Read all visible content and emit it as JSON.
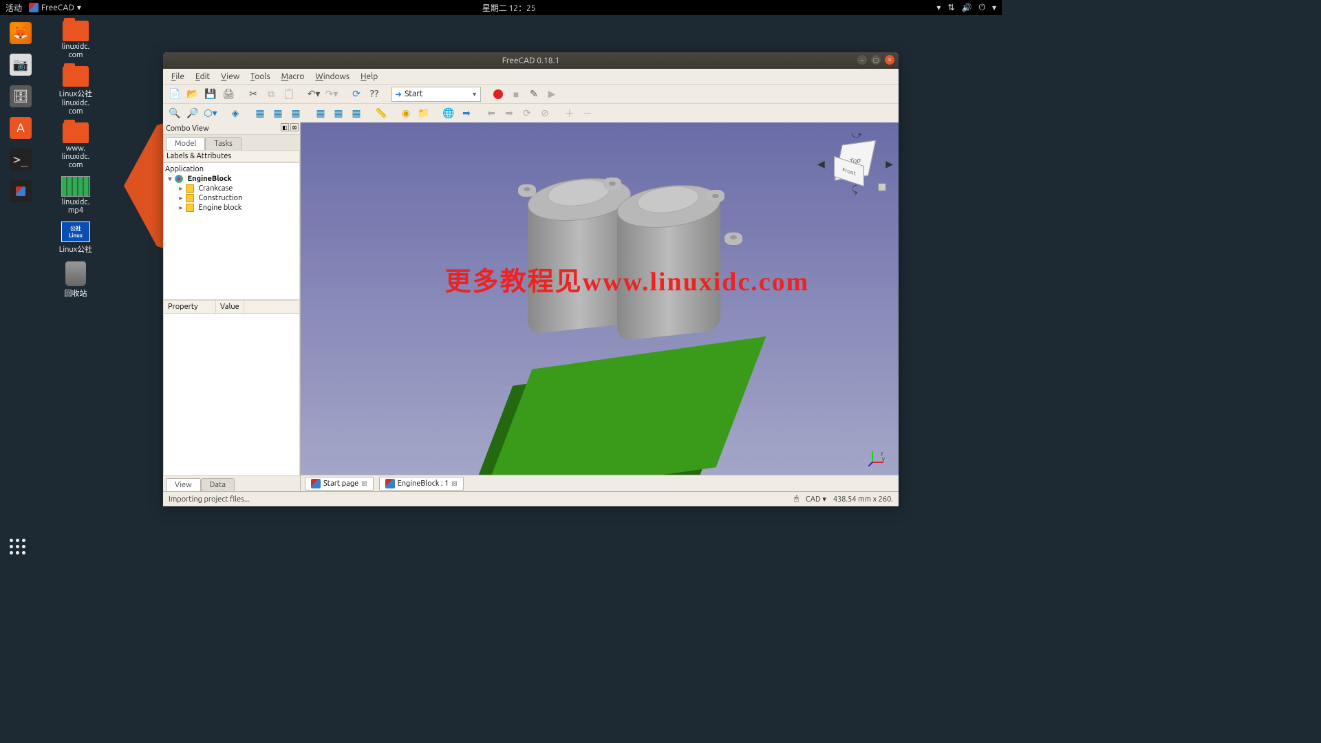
{
  "topbar": {
    "activities": "活动",
    "app_name": "FreeCAD",
    "clock": "星期二 12：25"
  },
  "desktop_icons": [
    {
      "label": "linuxidc.\ncom"
    },
    {
      "label": "Linux公社\nlinuxidc.\ncom"
    },
    {
      "label": "www.\nlinuxidc.\ncom"
    },
    {
      "label": "linuxidc.\nmp4"
    },
    {
      "label": "Linux公社"
    },
    {
      "label": "回收站"
    }
  ],
  "window": {
    "title": "FreeCAD 0.18.1",
    "menus": [
      "File",
      "Edit",
      "View",
      "Tools",
      "Macro",
      "Windows",
      "Help"
    ],
    "workbench": "Start",
    "combo": {
      "title": "Combo View",
      "tabs": [
        "Model",
        "Tasks"
      ],
      "tree_header": "Labels & Attributes",
      "app_root": "Application",
      "doc": "EngineBlock",
      "nodes": [
        "Crankcase",
        "Construction",
        "Engine block"
      ],
      "prop_headers": [
        "Property",
        "Value"
      ],
      "bottom_tabs": [
        "View",
        "Data"
      ]
    },
    "doc_tabs": [
      {
        "label": "Start page"
      },
      {
        "label": "EngineBlock : 1"
      }
    ],
    "status": {
      "left": "Importing project files...",
      "nav": "CAD",
      "dims": "438.54 mm x 260."
    },
    "navcube": {
      "top": "Top",
      "front": "Front"
    },
    "watermark": "更多教程见www.linuxidc.com"
  }
}
